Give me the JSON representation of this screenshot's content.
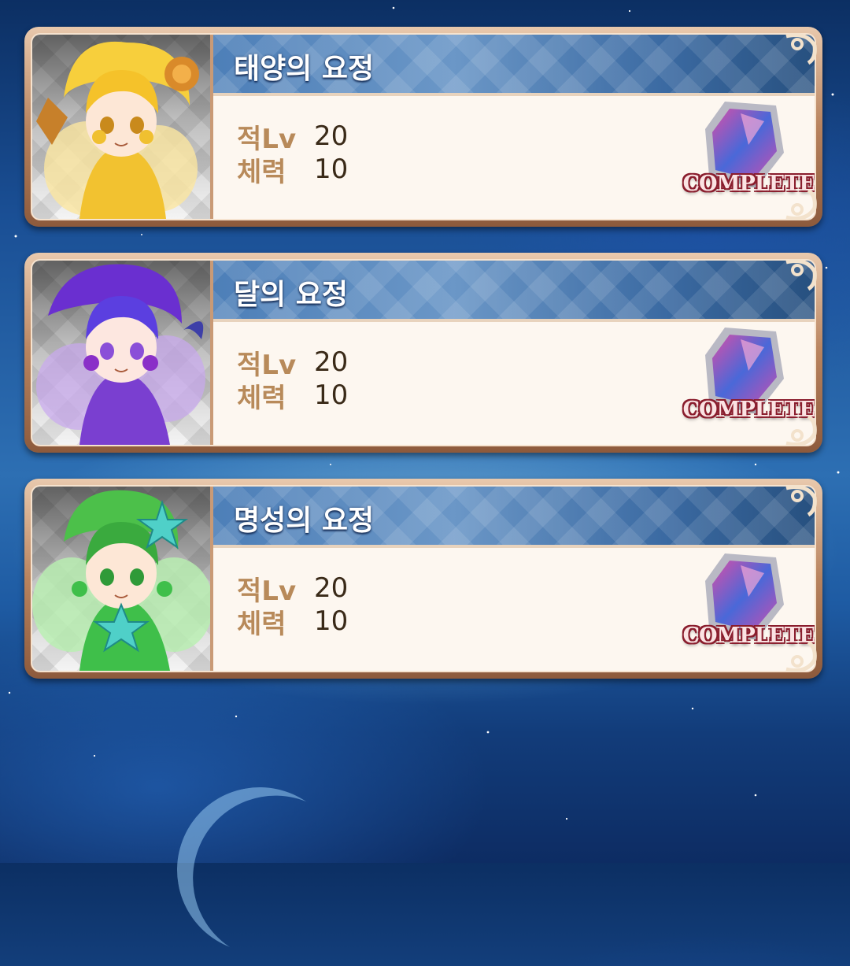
{
  "cards": [
    {
      "name": "태양의 요정",
      "level_label": "적Lv",
      "level_value": "20",
      "hp_label": "체력",
      "hp_value": "10",
      "status": "COMPLETE",
      "theme_color": "#f2c230"
    },
    {
      "name": "달의 요정",
      "level_label": "적Lv",
      "level_value": "20",
      "hp_label": "체력",
      "hp_value": "10",
      "status": "COMPLETE",
      "theme_color": "#7a3fd0"
    },
    {
      "name": "명성의 요정",
      "level_label": "적Lv",
      "level_value": "20",
      "hp_label": "체력",
      "hp_value": "10",
      "status": "COMPLETE",
      "theme_color": "#3fbf4a"
    }
  ],
  "icons": [
    "fairy-portrait-icon",
    "gem-icon",
    "corner-ornament-icon",
    "moon-icon"
  ],
  "colors": {
    "title_bar": "#4d7fb8",
    "frame": "#b8835e",
    "stat_label": "#b88a5a",
    "complete_outline": "#8a1d2d"
  }
}
